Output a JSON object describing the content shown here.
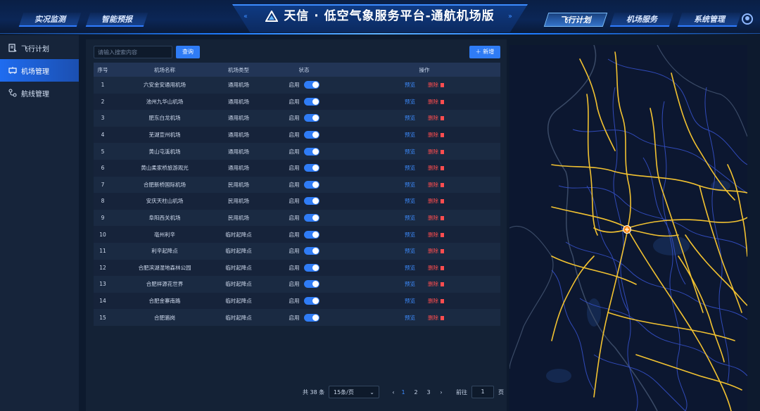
{
  "header": {
    "title": "天信 · 低空气象服务平台-通航机场版",
    "nav_left": [
      "实况监测",
      "智能预报"
    ],
    "nav_right": [
      "飞行计划",
      "机场服务",
      "系统管理"
    ],
    "active_nav": "飞行计划"
  },
  "sidebar": {
    "items": [
      {
        "label": "飞行计划",
        "icon": "flight-plan-icon"
      },
      {
        "label": "机场管理",
        "icon": "airport-icon"
      },
      {
        "label": "航线管理",
        "icon": "route-icon"
      }
    ],
    "active_index": 1
  },
  "toolbar": {
    "search_placeholder": "请输入搜索内容",
    "search_button": "查询",
    "add_button": "新增",
    "add_icon": "plus-icon"
  },
  "table": {
    "columns": [
      "序号",
      "机场名称",
      "机场类型",
      "状态",
      "操作"
    ],
    "status_label": "启用",
    "action_preview": "预览",
    "action_delete": "删除",
    "rows": [
      {
        "no": "1",
        "name": "六安金安通用机场",
        "type": "通用机场"
      },
      {
        "no": "2",
        "name": "池州九华山机场",
        "type": "通用机场"
      },
      {
        "no": "3",
        "name": "肥东白龙机场",
        "type": "通用机场"
      },
      {
        "no": "4",
        "name": "芜湖宣州机场",
        "type": "通用机场"
      },
      {
        "no": "5",
        "name": "黄山屯溪机场",
        "type": "通用机场"
      },
      {
        "no": "6",
        "name": "黄山柔家桥旅游观光",
        "type": "通用机场"
      },
      {
        "no": "7",
        "name": "合肥新桥国际机场",
        "type": "民用机场"
      },
      {
        "no": "8",
        "name": "安庆天柱山机场",
        "type": "民用机场"
      },
      {
        "no": "9",
        "name": "阜阳西关机场",
        "type": "民用机场"
      },
      {
        "no": "10",
        "name": "亳州利辛",
        "type": "临时起降点"
      },
      {
        "no": "11",
        "name": "利辛起降点",
        "type": "临时起降点"
      },
      {
        "no": "12",
        "name": "合肥滨湖湿地森林公园",
        "type": "临时起降点"
      },
      {
        "no": "13",
        "name": "合肥祥源花世界",
        "type": "临时起降点"
      },
      {
        "no": "14",
        "name": "合肥金寨南路",
        "type": "临时起降点"
      },
      {
        "no": "15",
        "name": "合肥骆岗",
        "type": "临时起降点"
      }
    ]
  },
  "pagination": {
    "total_text": "共 38 条",
    "page_size": "15条/页",
    "pages": [
      "1",
      "2",
      "3"
    ],
    "current_page": "1",
    "goto_prefix": "前往",
    "goto_value": "1",
    "goto_suffix": "页"
  },
  "colors": {
    "accent": "#2f7cf6",
    "delete": "#ff4d4f",
    "road": "#f2c230",
    "boundary": "#3d5fd6",
    "marker": "#ff8c1a"
  }
}
